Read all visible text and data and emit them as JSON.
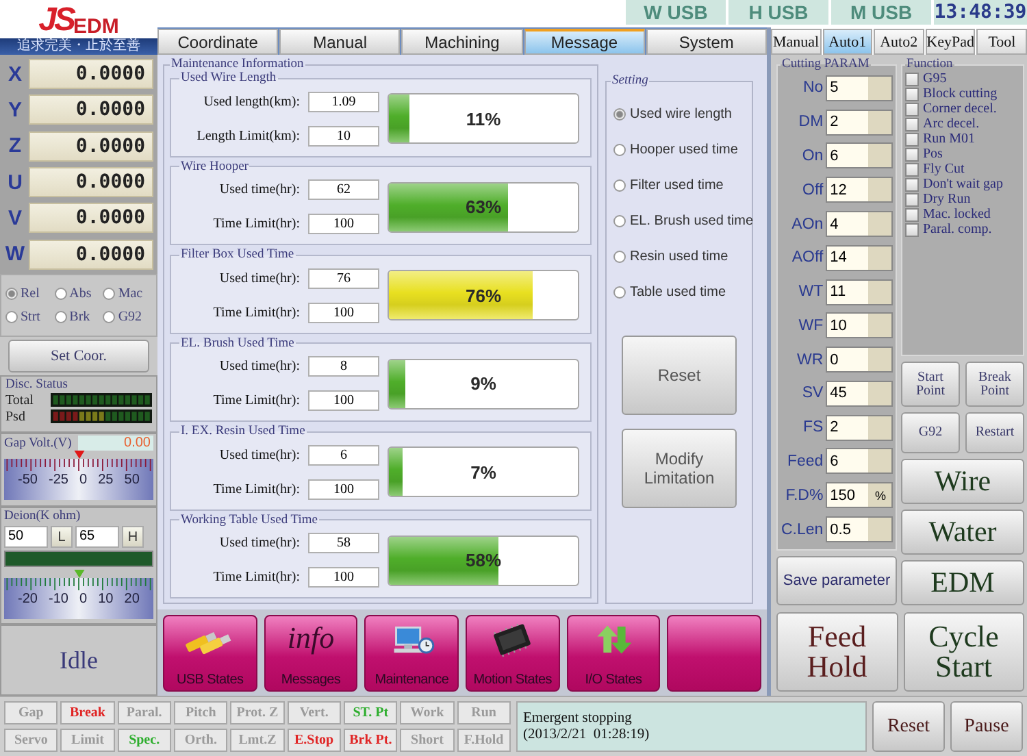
{
  "logo": {
    "brand": "JS",
    "suffix": "EDM",
    "tagline": "追求完美・止於至善"
  },
  "usb_status": [
    "W USB",
    "H USB",
    "M USB"
  ],
  "clock": "13:48:39",
  "axes": [
    {
      "name": "X",
      "value": "0.0000"
    },
    {
      "name": "Y",
      "value": "0.0000"
    },
    {
      "name": "Z",
      "value": "0.0000"
    },
    {
      "name": "U",
      "value": "0.0000"
    },
    {
      "name": "V",
      "value": "0.0000"
    },
    {
      "name": "W",
      "value": "0.0000"
    }
  ],
  "coord_modes": [
    {
      "label": "Rel",
      "selected": true
    },
    {
      "label": "Abs",
      "selected": false
    },
    {
      "label": "Mac",
      "selected": false
    },
    {
      "label": "Strt",
      "selected": false
    },
    {
      "label": "Brk",
      "selected": false
    },
    {
      "label": "G92",
      "selected": false
    }
  ],
  "set_coor_button": "Set Coor.",
  "disc_status": {
    "title": "Disc. Status",
    "rows": [
      "Total",
      "Psd"
    ]
  },
  "gap_volt": {
    "title": "Gap Volt.(V)",
    "reading": "0.00",
    "scale": [
      "-50",
      "-25",
      "0",
      "25",
      "50"
    ]
  },
  "deion": {
    "title": "Deion(K ohm)",
    "low": "50",
    "low_button": "L",
    "high": "65",
    "high_button": "H",
    "scale": [
      "-20",
      "-10",
      "0",
      "10",
      "20"
    ]
  },
  "state": "Idle",
  "main_tabs": [
    {
      "label": "Coordinate",
      "selected": false
    },
    {
      "label": "Manual",
      "selected": false
    },
    {
      "label": "Machining",
      "selected": false
    },
    {
      "label": "Message",
      "selected": true
    },
    {
      "label": "System",
      "selected": false
    }
  ],
  "maintenance": {
    "title": "Maintenance Information",
    "groups": [
      {
        "title": "Used Wire Length",
        "rows": [
          {
            "label": "Used length(km):",
            "value": "1.09"
          },
          {
            "label": "Length Limit(km):",
            "value": "10"
          }
        ],
        "level": 0.11,
        "percent": "11%",
        "color": "#4fae2a"
      },
      {
        "title": "Wire Hooper",
        "rows": [
          {
            "label": "Used time(hr):",
            "value": "62"
          },
          {
            "label": "Time Limit(hr):",
            "value": "100"
          }
        ],
        "level": 0.63,
        "percent": "63%",
        "color": "#4fae2a"
      },
      {
        "title": "Filter Box Used Time",
        "rows": [
          {
            "label": "Used time(hr):",
            "value": "76"
          },
          {
            "label": "Time Limit(hr):",
            "value": "100"
          }
        ],
        "level": 0.76,
        "percent": "76%",
        "color": "#e8e020"
      },
      {
        "title": "EL. Brush Used Time",
        "rows": [
          {
            "label": "Used time(hr):",
            "value": "8"
          },
          {
            "label": "Time Limit(hr):",
            "value": "100"
          }
        ],
        "level": 0.09,
        "percent": "9%",
        "color": "#4fae2a"
      },
      {
        "title": "I. EX. Resin Used Time",
        "rows": [
          {
            "label": "Used time(hr):",
            "value": "6"
          },
          {
            "label": "Time Limit(hr):",
            "value": "100"
          }
        ],
        "level": 0.07,
        "percent": "7%",
        "color": "#4fae2a"
      },
      {
        "title": "Working Table Used Time",
        "rows": [
          {
            "label": "Used time(hr):",
            "value": "58"
          },
          {
            "label": "Time Limit(hr):",
            "value": "100"
          }
        ],
        "level": 0.58,
        "percent": "58%",
        "color": "#4fae2a"
      }
    ]
  },
  "setting": {
    "title": "Setting",
    "options": [
      {
        "label": "Used wire length",
        "selected": true
      },
      {
        "label": "Hooper used time",
        "selected": false
      },
      {
        "label": "Filter used time",
        "selected": false
      },
      {
        "label": "EL. Brush used time",
        "selected": false
      },
      {
        "label": "Resin used time",
        "selected": false
      },
      {
        "label": "Table used time",
        "selected": false
      }
    ],
    "buttons": [
      "Reset",
      "Modify Limitation"
    ]
  },
  "shortcuts": [
    {
      "kind": "usb",
      "label": "USB States"
    },
    {
      "kind": "info",
      "icon_text": "info",
      "label": "Messages"
    },
    {
      "kind": "computer",
      "label": "Maintenance"
    },
    {
      "kind": "chip",
      "label": "Motion States"
    },
    {
      "kind": "io",
      "label": "I/O States"
    },
    {
      "kind": "blank"
    }
  ],
  "side_tabs": [
    {
      "label": "Manual",
      "selected": false
    },
    {
      "label": "Auto1",
      "selected": true
    },
    {
      "label": "Auto2",
      "selected": false
    },
    {
      "label": "KeyPad",
      "selected": false
    },
    {
      "label": "Tool",
      "selected": false
    }
  ],
  "cutting_param": {
    "title": "Cutting PARAM",
    "params": [
      {
        "label": "No",
        "value": "5"
      },
      {
        "label": "DM",
        "value": "2"
      },
      {
        "label": "On",
        "value": "6"
      },
      {
        "label": "Off",
        "value": "12"
      },
      {
        "label": "AOn",
        "value": "4"
      },
      {
        "label": "AOff",
        "value": "14"
      },
      {
        "label": "WT",
        "value": "11"
      },
      {
        "label": "WF",
        "value": "10"
      },
      {
        "label": "WR",
        "value": "0"
      },
      {
        "label": "SV",
        "value": "45"
      },
      {
        "label": "FS",
        "value": "2"
      },
      {
        "label": "Feed",
        "value": "6"
      },
      {
        "label": "F.D%",
        "value": "150",
        "unit": "%"
      },
      {
        "label": "C.Len",
        "value": "0.5"
      }
    ],
    "save_button": "Save parameter"
  },
  "function": {
    "title": "Function",
    "options": [
      {
        "label": "G95",
        "checked": false
      },
      {
        "label": "Block cutting",
        "checked": false
      },
      {
        "label": "Corner decel.",
        "checked": false
      },
      {
        "label": "Arc decel.",
        "checked": false
      },
      {
        "label": "Run M01",
        "checked": false
      },
      {
        "label": "Pos",
        "checked": false
      },
      {
        "label": "Fly Cut",
        "checked": false
      },
      {
        "label": "Don't wait gap",
        "checked": false
      },
      {
        "label": "Dry Run",
        "checked": false
      },
      {
        "label": "Mac. locked",
        "checked": false
      },
      {
        "label": "Paral. comp.",
        "checked": false
      }
    ]
  },
  "small_buttons": [
    "Start Point",
    "Break Point",
    "G92",
    "Restart"
  ],
  "mode_buttons": [
    "Wire",
    "Water",
    "EDM"
  ],
  "big_buttons": [
    {
      "kind": "hold",
      "label": "Feed Hold"
    },
    {
      "kind": "start",
      "label": "Cycle Start"
    }
  ],
  "indicators": [
    {
      "label": "Gap",
      "color": "#9a9a9a"
    },
    {
      "label": "Break",
      "color": "#e02424"
    },
    {
      "label": "Paral.",
      "color": "#9a9a9a"
    },
    {
      "label": "Pitch",
      "color": "#9a9a9a"
    },
    {
      "label": "Prot. Z",
      "color": "#9a9a9a"
    },
    {
      "label": "Vert.",
      "color": "#9a9a9a"
    },
    {
      "label": "ST. Pt",
      "color": "#2eae2e"
    },
    {
      "label": "Work",
      "color": "#9a9a9a"
    },
    {
      "label": "Run",
      "color": "#9a9a9a"
    },
    {
      "label": "Servo",
      "color": "#9a9a9a"
    },
    {
      "label": "Limit",
      "color": "#9a9a9a"
    },
    {
      "label": "Spec.",
      "color": "#2eae2e"
    },
    {
      "label": "Orth.",
      "color": "#9a9a9a"
    },
    {
      "label": "Lmt.Z",
      "color": "#9a9a9a"
    },
    {
      "label": "E.Stop",
      "color": "#e02424"
    },
    {
      "label": "Brk Pt.",
      "color": "#e02424"
    },
    {
      "label": "Short",
      "color": "#9a9a9a"
    },
    {
      "label": "F.Hold",
      "color": "#9a9a9a"
    }
  ],
  "message": [
    "Emergent stopping",
    "(2013/2/21  01:28:19)"
  ],
  "footer_buttons": [
    "Reset",
    "Pause"
  ]
}
